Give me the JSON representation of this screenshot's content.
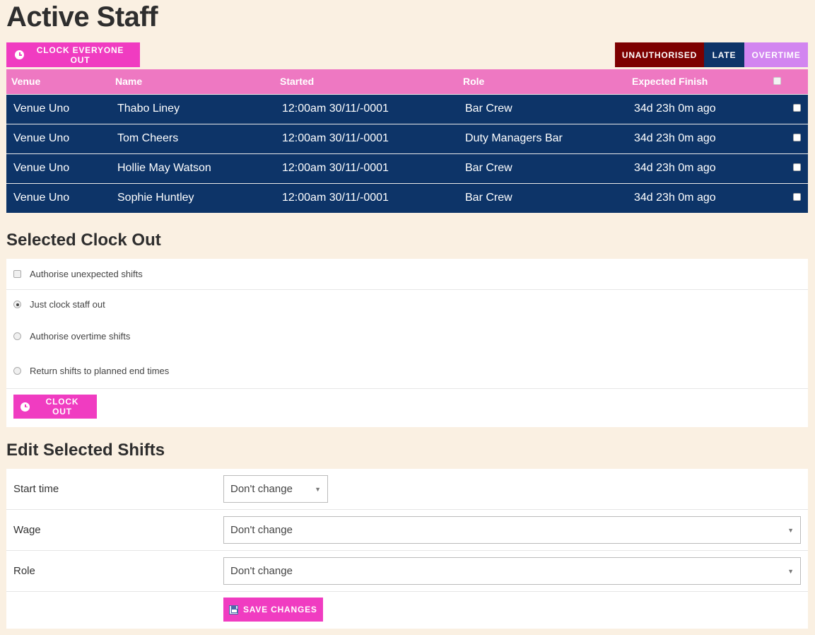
{
  "page": {
    "title": "Active Staff"
  },
  "toolbar": {
    "clock_everyone_out": "CLOCK EVERYONE OUT"
  },
  "filters": {
    "unauthorised": "UNAUTHORISED",
    "late": "LATE",
    "overtime": "OVERTIME"
  },
  "table": {
    "headers": {
      "venue": "Venue",
      "name": "Name",
      "started": "Started",
      "role": "Role",
      "expected_finish": "Expected Finish"
    },
    "rows": [
      {
        "venue": "Venue Uno",
        "name": "Thabo Liney",
        "started": "12:00am 30/11/-0001",
        "role": "Bar Crew",
        "expected_finish": "34d 23h 0m ago"
      },
      {
        "venue": "Venue Uno",
        "name": "Tom Cheers",
        "started": "12:00am 30/11/-0001",
        "role": "Duty Managers Bar",
        "expected_finish": "34d 23h 0m ago"
      },
      {
        "venue": "Venue Uno",
        "name": "Hollie May Watson",
        "started": "12:00am 30/11/-0001",
        "role": "Bar Crew",
        "expected_finish": "34d 23h 0m ago"
      },
      {
        "venue": "Venue Uno",
        "name": "Sophie Huntley",
        "started": "12:00am 30/11/-0001",
        "role": "Bar Crew",
        "expected_finish": "34d 23h 0m ago"
      }
    ]
  },
  "clock_out": {
    "title": "Selected Clock Out",
    "authorise_unexpected": "Authorise unexpected shifts",
    "options": [
      "Just clock staff out",
      "Authorise overtime shifts",
      "Return shifts to planned end times"
    ],
    "selected_option": "Just clock staff out",
    "button": "CLOCK OUT"
  },
  "edit": {
    "title": "Edit Selected Shifts",
    "start_time_label": "Start time",
    "start_time_value": "Don't change",
    "wage_label": "Wage",
    "wage_value": "Don't change",
    "role_label": "Role",
    "role_value": "Don't change",
    "save_button": "SAVE CHANGES"
  },
  "colors": {
    "background": "#faf0e2",
    "accent_pink": "#f03cc1",
    "header_pink": "#ee78c2",
    "navy": "#0d3468",
    "unauthorised": "#7d0000",
    "overtime": "#d285f0"
  }
}
